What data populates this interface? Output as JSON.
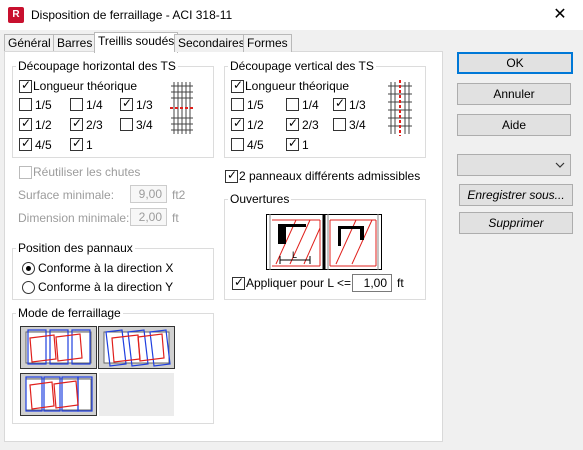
{
  "window": {
    "title": "Disposition de ferraillage - ACI 318-11",
    "app_icon": "R",
    "close_glyph": "✕"
  },
  "tabs": [
    {
      "label": "Général"
    },
    {
      "label": "Barres"
    },
    {
      "label": "Treillis soudés",
      "active": true
    },
    {
      "label": "Secondaires"
    },
    {
      "label": "Formes"
    }
  ],
  "horizontal": {
    "title": "Découpage horizontal des TS",
    "theoretical_label": "Longueur théorique",
    "theoretical_checked": true,
    "options": [
      {
        "label": "1/5",
        "checked": false
      },
      {
        "label": "1/4",
        "checked": false
      },
      {
        "label": "1/3",
        "checked": true
      },
      {
        "label": "1/2",
        "checked": true
      },
      {
        "label": "2/3",
        "checked": true
      },
      {
        "label": "3/4",
        "checked": false
      },
      {
        "label": "4/5",
        "checked": true
      },
      {
        "label": "1",
        "checked": true
      }
    ]
  },
  "vertical": {
    "title": "Découpage vertical des TS",
    "theoretical_label": "Longueur théorique",
    "theoretical_checked": true,
    "options": [
      {
        "label": "1/5",
        "checked": false
      },
      {
        "label": "1/4",
        "checked": false
      },
      {
        "label": "1/3",
        "checked": true
      },
      {
        "label": "1/2",
        "checked": true
      },
      {
        "label": "2/3",
        "checked": true
      },
      {
        "label": "3/4",
        "checked": false
      },
      {
        "label": "4/5",
        "checked": false
      },
      {
        "label": "1",
        "checked": true
      }
    ]
  },
  "reuse": {
    "label": "Réutiliser les chutes",
    "checked": false,
    "surface_label": "Surface minimale:",
    "surface_value": "9,00",
    "surface_unit": "ft2",
    "dimension_label": "Dimension minimale:",
    "dimension_value": "2,00",
    "dimension_unit": "ft"
  },
  "two_panels": {
    "label": "2 panneaux différents admissibles",
    "checked": true
  },
  "openings": {
    "title": "Ouvertures",
    "apply_label": "Appliquer pour L <=",
    "apply_checked": true,
    "value": "1,00",
    "unit": "ft",
    "diagram_label": "L"
  },
  "position": {
    "title": "Position des pannaux",
    "options": [
      {
        "label": "Conforme à la direction X",
        "selected": true
      },
      {
        "label": "Conforme à la direction Y",
        "selected": false
      }
    ]
  },
  "mode": {
    "title": "Mode de ferraillage"
  },
  "buttons": {
    "ok": "OK",
    "cancel": "Annuler",
    "help": "Aide",
    "save_as": "Enregistrer sous...",
    "delete": "Supprimer"
  },
  "preset_select": {
    "value": ""
  },
  "colors": {
    "accent": "#0078d7",
    "mesh_red": "#e0201c",
    "mesh_blue": "#1f3fe0"
  }
}
